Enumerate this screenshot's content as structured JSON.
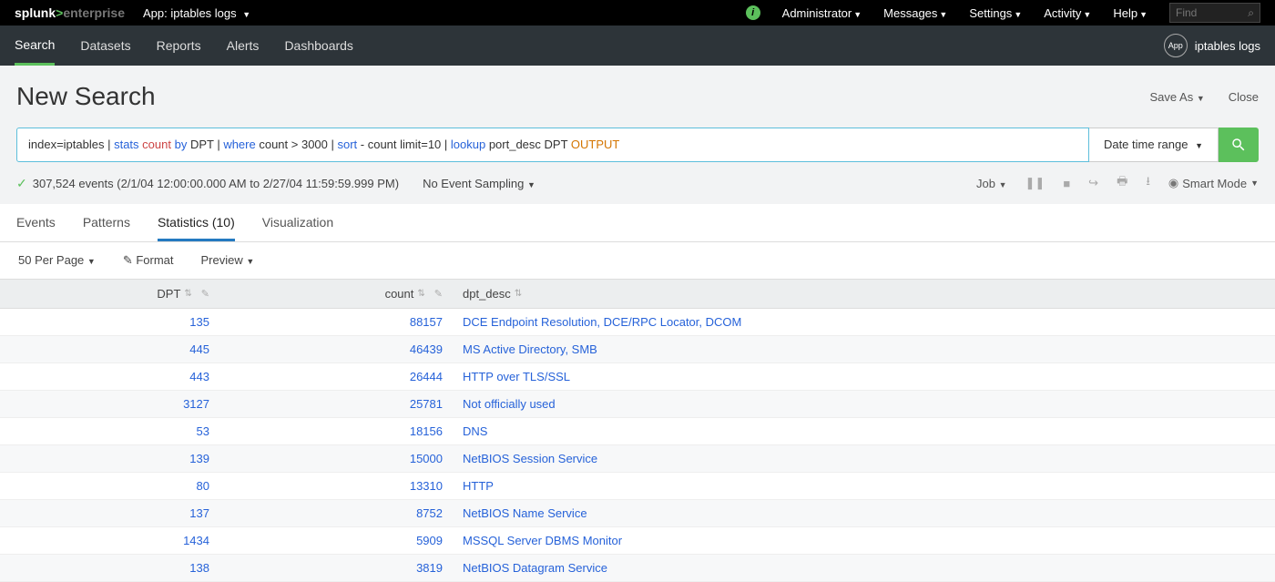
{
  "brand": {
    "part1": "splunk",
    "sep": ">",
    "part2": "enterprise"
  },
  "app": {
    "label": "App: iptables logs"
  },
  "topmenu": {
    "admin": "Administrator",
    "messages": "Messages",
    "settings": "Settings",
    "activity": "Activity",
    "help": "Help",
    "find_placeholder": "Find"
  },
  "nav": {
    "search": "Search",
    "datasets": "Datasets",
    "reports": "Reports",
    "alerts": "Alerts",
    "dashboards": "Dashboards",
    "app_name": "iptables logs",
    "app_badge": "App"
  },
  "page": {
    "title": "New Search",
    "save_as": "Save As",
    "close": "Close"
  },
  "search": {
    "t1": "index=iptables | ",
    "t2": "stats",
    "t3": " count ",
    "t4": "by",
    "t5": " DPT | ",
    "t6": "where",
    "t7": " count > 3000 | ",
    "t8": "sort",
    "t9": " - count limit=10 | ",
    "t10": "lookup",
    "t11": " port_desc DPT ",
    "t12": "OUTPUT",
    "time_range": "Date time range"
  },
  "status": {
    "events": "307,524 events (2/1/04 12:00:00.000 AM to 2/27/04 11:59:59.999 PM)",
    "sampling": "No Event Sampling",
    "job": "Job",
    "smart": "Smart Mode"
  },
  "tabs": {
    "events": "Events",
    "patterns": "Patterns",
    "statistics": "Statistics (10)",
    "visualization": "Visualization"
  },
  "controls": {
    "perpage": "50 Per Page",
    "format": "Format",
    "preview": "Preview"
  },
  "columns": {
    "dpt": "DPT",
    "count": "count",
    "desc": "dpt_desc"
  },
  "rows": [
    {
      "dpt": "135",
      "count": "88157",
      "desc": "DCE Endpoint Resolution, DCE/RPC Locator, DCOM"
    },
    {
      "dpt": "445",
      "count": "46439",
      "desc": "MS Active Directory, SMB"
    },
    {
      "dpt": "443",
      "count": "26444",
      "desc": "HTTP over TLS/SSL"
    },
    {
      "dpt": "3127",
      "count": "25781",
      "desc": "Not officially used"
    },
    {
      "dpt": "53",
      "count": "18156",
      "desc": "DNS"
    },
    {
      "dpt": "139",
      "count": "15000",
      "desc": "NetBIOS Session Service"
    },
    {
      "dpt": "80",
      "count": "13310",
      "desc": "HTTP"
    },
    {
      "dpt": "137",
      "count": "8752",
      "desc": "NetBIOS Name Service"
    },
    {
      "dpt": "1434",
      "count": "5909",
      "desc": "MSSQL Server DBMS Monitor"
    },
    {
      "dpt": "138",
      "count": "3819",
      "desc": "NetBIOS Datagram Service"
    }
  ]
}
